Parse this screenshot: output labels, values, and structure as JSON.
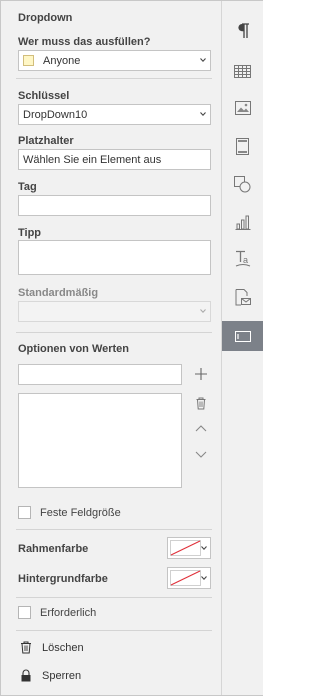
{
  "panel": {
    "title": "Dropdown",
    "who_label": "Wer muss das ausfüllen?",
    "who_value": "Anyone",
    "key_label": "Schlüssel",
    "key_value": "DropDown10",
    "placeholder_label": "Platzhalter",
    "placeholder_value": "Wählen Sie ein Element aus",
    "tag_label": "Tag",
    "tag_value": "",
    "tip_label": "Tipp",
    "tip_value": "",
    "default_label": "Standardmäßig",
    "default_value": "",
    "options_label": "Optionen von Werten",
    "option_input_value": "",
    "fixed_size_label": "Feste Feldgröße",
    "border_color_label": "Rahmenfarbe",
    "background_color_label": "Hintergrundfarbe",
    "required_label": "Erforderlich",
    "delete_label": "Löschen",
    "lock_label": "Sperren"
  },
  "colors": {
    "swatch_anyone": "#fff7c6",
    "no_color_line": "#e0303a",
    "active_rail": "#7c8189"
  },
  "rail": {
    "items": [
      {
        "icon": "paragraph-icon"
      },
      {
        "icon": "table-icon"
      },
      {
        "icon": "image-icon"
      },
      {
        "icon": "header-footer-icon"
      },
      {
        "icon": "shape-icon"
      },
      {
        "icon": "chart-icon"
      },
      {
        "icon": "text-art-icon"
      },
      {
        "icon": "mail-merge-icon"
      },
      {
        "icon": "form-field-icon",
        "active": true
      }
    ]
  }
}
